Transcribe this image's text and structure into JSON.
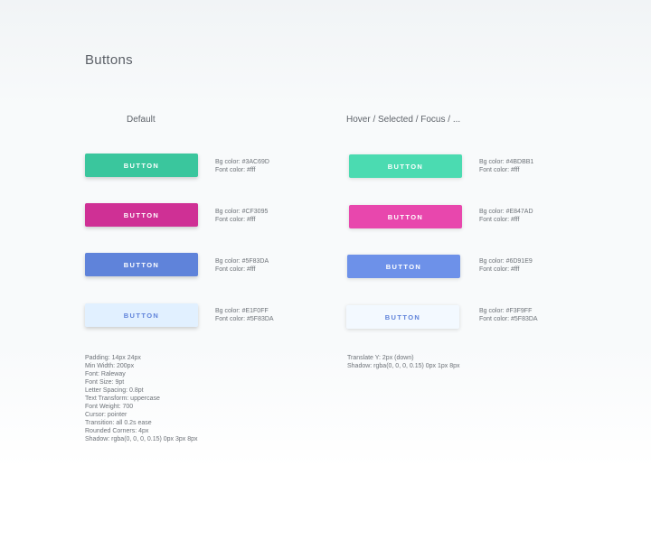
{
  "title": "Buttons",
  "columns": {
    "default": "Default",
    "hover": "Hover / Selected / Focus / ..."
  },
  "button_label": "BUTTON",
  "default_buttons": [
    {
      "bg_label": "Bg color: #3AC69D",
      "font_label": "Font color: #fff",
      "bg": "#3AC69D",
      "fg": "#ffffff"
    },
    {
      "bg_label": "Bg color: #CF3095",
      "font_label": "Font color: #fff",
      "bg": "#CF3095",
      "fg": "#ffffff"
    },
    {
      "bg_label": "Bg color: #5F83DA",
      "font_label": "Font color: #fff",
      "bg": "#5F83DA",
      "fg": "#ffffff"
    },
    {
      "bg_label": "Bg color: #E1F0FF",
      "font_label": "Font color: #5F83DA",
      "bg": "#E1F0FF",
      "fg": "#5F83DA"
    }
  ],
  "hover_buttons": [
    {
      "bg_label": "Bg color: #4BDBB1",
      "font_label": "Font color: #fff",
      "bg": "#4BDBB1",
      "fg": "#ffffff"
    },
    {
      "bg_label": "Bg color: #E847AD",
      "font_label": "Font color: #fff",
      "bg": "#E847AD",
      "fg": "#ffffff"
    },
    {
      "bg_label": "Bg color: #6D91E9",
      "font_label": "Font color: #fff",
      "bg": "#6D91E9",
      "fg": "#ffffff"
    },
    {
      "bg_label": "Bg color: #F3F9FF",
      "font_label": "Font color: #5F83DA",
      "bg": "#F3F9FF",
      "fg": "#5F83DA"
    }
  ],
  "default_notes": [
    "Padding: 14px 24px",
    "Min Width: 200px",
    "Font: Raleway",
    "Font Size: 9pt",
    "Letter Spacing: 0.8pt",
    "Text Transform: uppercase",
    "Font Weight: 700",
    "Cursor: pointer",
    "Transition: all 0.2s ease",
    "Rounded Corners: 4px",
    "Shadow: rgba(0, 0, 0, 0.15) 0px 3px 8px"
  ],
  "hover_notes": [
    "Translate Y: 2px (down)",
    "Shadow: rgba(0, 0, 0, 0.15) 0px 1px 8px"
  ]
}
